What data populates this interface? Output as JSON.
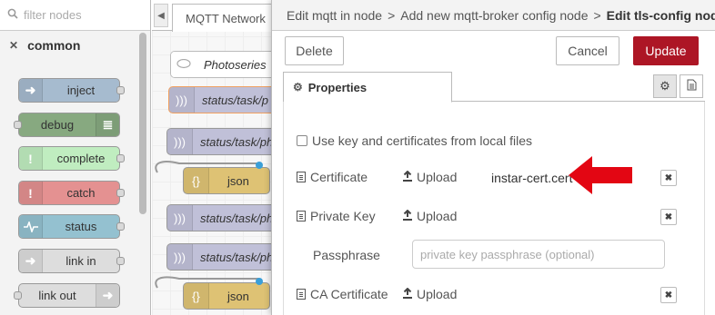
{
  "palette": {
    "search_placeholder": "filter nodes",
    "category": "common",
    "nodes": [
      {
        "label": "inject",
        "color": "#a6bbcf"
      },
      {
        "label": "debug",
        "color": "#87a980"
      },
      {
        "label": "complete",
        "color": "#c0edc0"
      },
      {
        "label": "catch",
        "color": "#e49191"
      },
      {
        "label": "status",
        "color": "#94c1d0"
      },
      {
        "label": "link in",
        "color": "#dddddd"
      },
      {
        "label": "link out",
        "color": "#dddddd"
      }
    ]
  },
  "workspace": {
    "tab_label": "MQTT Network",
    "nodes": [
      {
        "label": "Photoseries",
        "kind": "comment"
      },
      {
        "label": "status/task/p",
        "kind": "mqtt-in"
      },
      {
        "label": "status/task/ph",
        "kind": "mqtt"
      },
      {
        "label": "json",
        "kind": "json"
      },
      {
        "label": "status/task/ph",
        "kind": "mqtt"
      },
      {
        "label": "status/task/ph",
        "kind": "mqtt"
      },
      {
        "label": "json",
        "kind": "json"
      }
    ]
  },
  "tray": {
    "breadcrumb": [
      "Edit mqtt in node",
      "Add new mqtt-broker config node"
    ],
    "breadcrumb_separator": ">",
    "title": "Edit tls-config node",
    "delete_label": "Delete",
    "cancel_label": "Cancel",
    "update_label": "Update",
    "tab_properties": "Properties",
    "use_key_label": "Use key and certificates from local files",
    "certificate_label": "Certificate",
    "certificate_file": "instar-cert.cert",
    "private_key_label": "Private Key",
    "passphrase_label": "Passphrase",
    "passphrase_placeholder": "private key passphrase (optional)",
    "passphrase_value": "",
    "ca_certificate_label": "CA Certificate",
    "upload_label": "Upload",
    "clear_symbol": "✖"
  },
  "colors": {
    "accent_update": "#ad1625",
    "annotation_arrow": "#e30613"
  }
}
